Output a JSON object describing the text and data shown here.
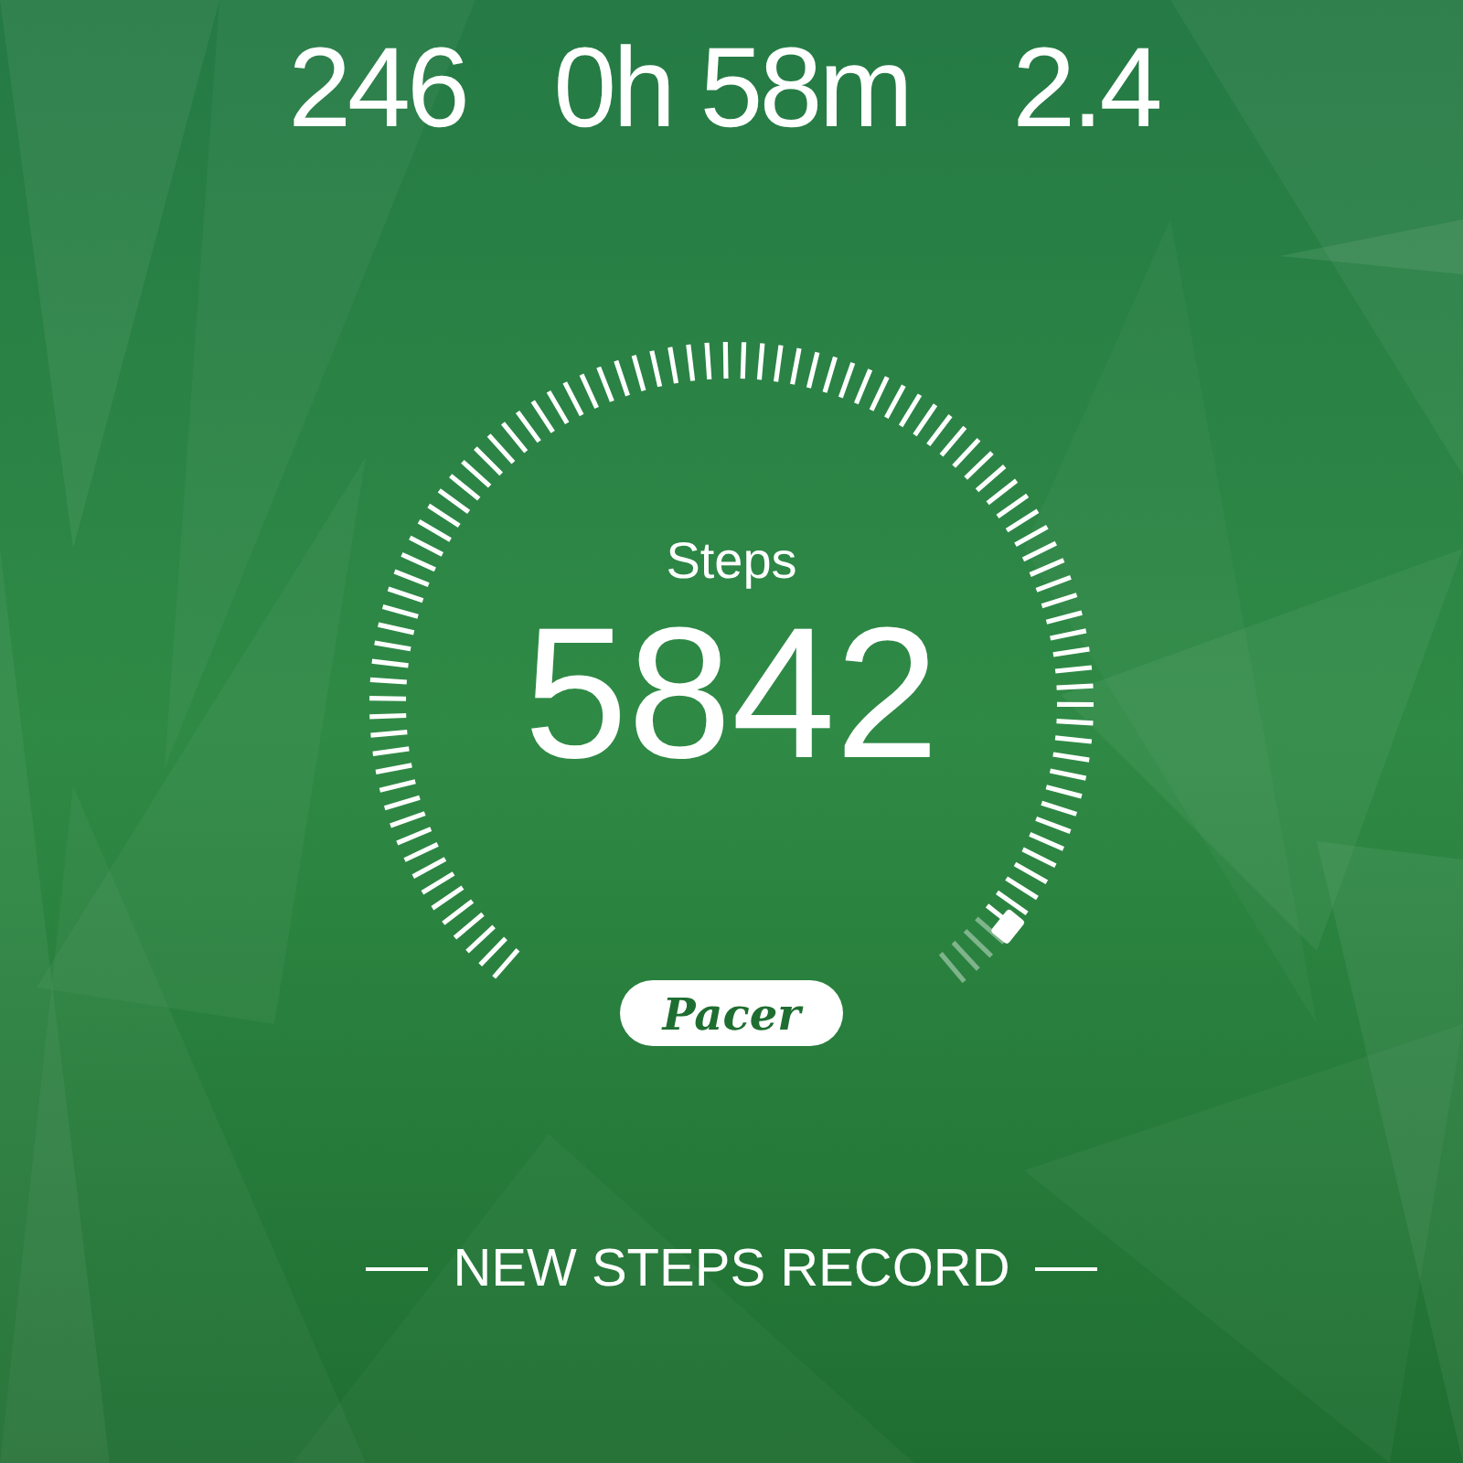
{
  "stats": [
    {
      "value": "246"
    },
    {
      "value": "0h 58m"
    },
    {
      "value": "2.4"
    }
  ],
  "gauge": {
    "label": "Steps",
    "value": "5842"
  },
  "logo": "Pacer",
  "banner": "NEW STEPS RECORD"
}
